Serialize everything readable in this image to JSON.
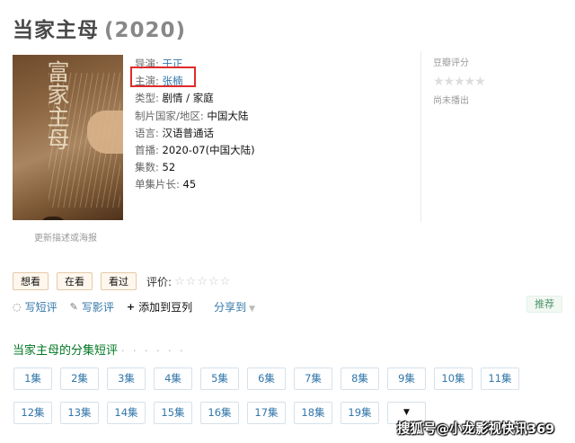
{
  "page": {
    "title": "当家主母",
    "year": "(2020)"
  },
  "poster": {
    "glyphs": "富家主母",
    "update_link": "更新描述或海报"
  },
  "info": [
    {
      "key": "导演: ",
      "value": "于正",
      "link": true
    },
    {
      "key": "主演: ",
      "value": "张楠",
      "link": true
    },
    {
      "key": "类型: ",
      "value": "剧情 / 家庭",
      "link": false
    },
    {
      "key": "制片国家/地区: ",
      "value": "中国大陆",
      "link": false
    },
    {
      "key": "语言: ",
      "value": "汉语普通话",
      "link": false
    },
    {
      "key": "首播: ",
      "value": "2020-07(中国大陆)",
      "link": false
    },
    {
      "key": "集数: ",
      "value": "52",
      "link": false
    },
    {
      "key": "单集片长: ",
      "value": "45",
      "link": false
    }
  ],
  "rating": {
    "label": "豆瓣评分",
    "stars": "★★★★★",
    "status": "尚未播出"
  },
  "actions": {
    "want": "想看",
    "watching": "在看",
    "watched": "看过",
    "rate_label": "评价:",
    "rate_stars": "☆☆☆☆☆"
  },
  "links": {
    "short_review": "写短评",
    "review": "写影评",
    "add_doulist": "添加到豆列",
    "share": "分享到",
    "recommend": "推荐"
  },
  "episodes": {
    "heading": "当家主母的分集短评",
    "dots": "· · · · · ·",
    "items": [
      "1集",
      "2集",
      "3集",
      "4集",
      "5集",
      "6集",
      "7集",
      "8集",
      "9集",
      "10集",
      "11集",
      "12集",
      "13集",
      "14集",
      "15集",
      "16集",
      "17集",
      "18集",
      "19集"
    ],
    "more": "▼"
  },
  "watermark": "搜狐号@小龙影视快讯369"
}
